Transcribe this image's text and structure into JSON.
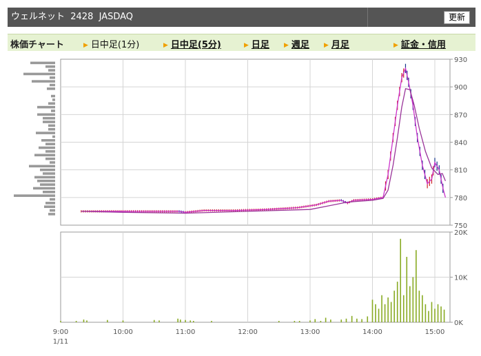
{
  "header": {
    "title": "ウェルネット  2428  JASDAQ",
    "refresh_label": "更新"
  },
  "nav": {
    "heading": "株価チャート",
    "items": [
      {
        "label": "日中足(1分)",
        "link": false
      },
      {
        "label": "日中足(5分)",
        "link": true
      },
      {
        "label": "日足",
        "link": true
      },
      {
        "label": "週足",
        "link": true
      },
      {
        "label": "月足",
        "link": true
      },
      {
        "label": "証金・信用",
        "link": true
      }
    ]
  },
  "colors": {
    "titlebar": "#555555",
    "nav_bg": "#e6f2d2",
    "ma1": "#cc33cc",
    "ma2": "#993399",
    "volume": "#88aa22",
    "profile": "#999999",
    "candle_up": "#cc2222",
    "candle_down": "#113388"
  },
  "chart_data": [
    {
      "type": "line",
      "title": "",
      "x_ticks": [
        "9:00",
        "10:00",
        "11:00",
        "12:00",
        "13:00",
        "14:00",
        "15:00"
      ],
      "x_date_label": "1/11",
      "y_ticks": [
        750,
        780,
        810,
        840,
        870,
        900,
        930
      ],
      "ylim": [
        750,
        930
      ],
      "series": [
        {
          "points": [
            [
              9.33,
              765
            ],
            [
              9.5,
              765
            ],
            [
              9.75,
              765
            ],
            [
              10.0,
              765
            ],
            [
              10.5,
              765
            ],
            [
              10.9,
              765
            ],
            [
              11.0,
              764
            ],
            [
              11.3,
              766
            ],
            [
              11.8,
              766
            ],
            [
              12.3,
              767
            ],
            [
              12.8,
              769
            ],
            [
              13.1,
              772
            ],
            [
              13.3,
              776
            ],
            [
              13.5,
              777
            ],
            [
              13.6,
              774
            ],
            [
              13.7,
              777
            ],
            [
              14.0,
              778
            ],
            [
              14.17,
              780
            ],
            [
              14.25,
              805
            ],
            [
              14.33,
              845
            ],
            [
              14.4,
              880
            ],
            [
              14.47,
              910
            ],
            [
              14.53,
              920
            ],
            [
              14.58,
              905
            ],
            [
              14.65,
              880
            ],
            [
              14.72,
              845
            ],
            [
              14.8,
              815
            ],
            [
              14.88,
              795
            ],
            [
              14.95,
              800
            ],
            [
              15.0,
              818
            ],
            [
              15.07,
              810
            ],
            [
              15.13,
              790
            ],
            [
              15.17,
              780
            ]
          ]
        },
        {
          "points": [
            [
              9.33,
              765
            ],
            [
              10.0,
              764
            ],
            [
              11.0,
              763
            ],
            [
              12.0,
              765
            ],
            [
              13.0,
              767
            ],
            [
              13.3,
              771
            ],
            [
              13.6,
              775
            ],
            [
              14.0,
              777
            ],
            [
              14.17,
              779
            ],
            [
              14.25,
              788
            ],
            [
              14.33,
              815
            ],
            [
              14.4,
              845
            ],
            [
              14.47,
              878
            ],
            [
              14.53,
              898
            ],
            [
              14.6,
              897
            ],
            [
              14.67,
              880
            ],
            [
              14.75,
              855
            ],
            [
              14.85,
              830
            ],
            [
              14.95,
              812
            ],
            [
              15.05,
              805
            ],
            [
              15.12,
              806
            ],
            [
              15.17,
              798
            ]
          ]
        }
      ]
    },
    {
      "type": "bar",
      "title": "",
      "y_ticks": [
        "0K",
        "10K",
        "20K"
      ],
      "ylim": [
        0,
        20000
      ],
      "x": [
        9.0,
        9.25,
        9.37,
        9.42,
        9.75,
        10.0,
        10.5,
        10.58,
        10.88,
        10.92,
        11.0,
        11.08,
        11.13,
        11.42,
        12.5,
        12.75,
        12.83,
        13.0,
        13.08,
        13.17,
        13.25,
        13.33,
        13.5,
        13.58,
        13.67,
        13.75,
        13.83,
        13.92,
        14.0,
        14.05,
        14.1,
        14.15,
        14.2,
        14.25,
        14.3,
        14.35,
        14.4,
        14.45,
        14.5,
        14.55,
        14.6,
        14.65,
        14.7,
        14.75,
        14.8,
        14.85,
        14.9,
        14.95,
        15.0,
        15.05,
        15.1,
        15.15
      ],
      "values": [
        300,
        300,
        600,
        400,
        500,
        400,
        500,
        400,
        800,
        600,
        500,
        400,
        300,
        300,
        300,
        300,
        300,
        400,
        700,
        300,
        1000,
        600,
        600,
        800,
        1400,
        800,
        700,
        1300,
        5000,
        4000,
        3000,
        6000,
        4000,
        5500,
        4500,
        7000,
        9000,
        18500,
        6000,
        14500,
        8000,
        10000,
        16000,
        7000,
        6000,
        4000,
        2500,
        4500,
        3000,
        4000,
        3500,
        2800
      ]
    },
    {
      "type": "bar",
      "title": "",
      "orientation": "horizontal",
      "y": [
        926,
        922,
        918,
        914,
        910,
        906,
        902,
        898,
        890,
        886,
        882,
        878,
        874,
        870,
        866,
        862,
        858,
        854,
        850,
        846,
        842,
        838,
        834,
        830,
        826,
        822,
        818,
        814,
        810,
        806,
        802,
        798,
        794,
        790,
        786,
        782,
        778,
        774,
        770,
        766,
        762
      ],
      "values": [
        36,
        14,
        10,
        46,
        8,
        34,
        8,
        12,
        6,
        4,
        10,
        26,
        6,
        26,
        18,
        18,
        10,
        10,
        28,
        4,
        20,
        14,
        24,
        14,
        30,
        14,
        8,
        38,
        22,
        18,
        30,
        26,
        22,
        32,
        18,
        60,
        8,
        14,
        16,
        8,
        10
      ]
    }
  ]
}
